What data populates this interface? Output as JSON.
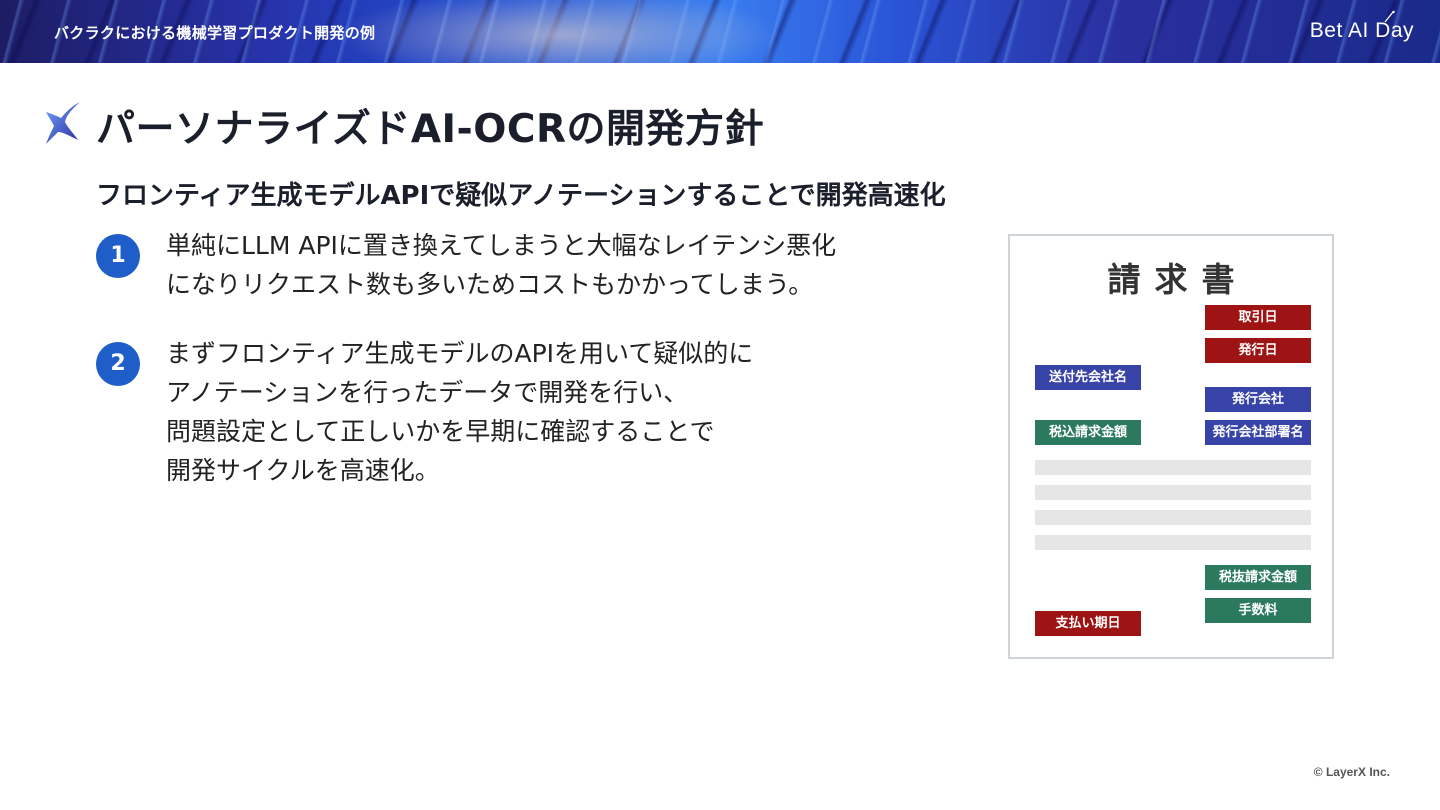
{
  "header": {
    "title": "バクラクにおける機械学習プロダクト開発の例",
    "brand": "Bet AI Day"
  },
  "slide": {
    "title": "パーソナライズドAI-OCRの開発方針",
    "subtitle": "フロンティア生成モデルAPIで疑似アノテーションすることで開発高速化",
    "points": [
      {
        "number": "1",
        "lines": [
          "単純にLLM APIに置き換えてしまうと大幅なレイテンシ悪化",
          "になりリクエスト数も多いためコストもかかってしまう。"
        ]
      },
      {
        "number": "2",
        "lines": [
          "まずフロンティア生成モデルのAPIを用いて疑似的に",
          "アノテーションを行ったデータで開発を行い、",
          "問題設定として正しいかを早期に確認することで",
          "開発サイクルを高速化。"
        ]
      }
    ]
  },
  "invoice": {
    "title": "請求書",
    "tags": {
      "trade_date": "取引日",
      "issue_date": "発行日",
      "recipient": "送付先会社名",
      "issuer": "発行会社",
      "total_incl_tax": "税込請求金額",
      "issuer_dept": "発行会社部署名",
      "total_excl_tax": "税抜請求金額",
      "fee": "手数料",
      "due_date": "支払い期日"
    },
    "colors": {
      "date": "#9e1414",
      "party": "#3843a8",
      "amount": "#2b7a5e"
    }
  },
  "footer": {
    "copyright": "© LayerX Inc."
  }
}
